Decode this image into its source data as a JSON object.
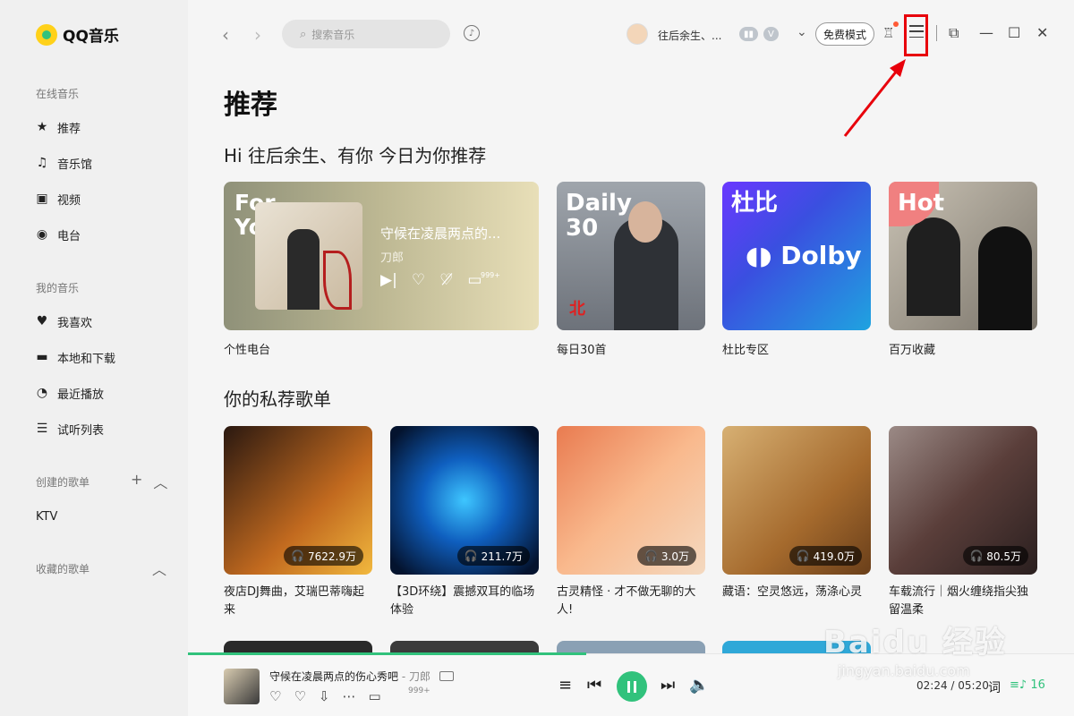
{
  "app": {
    "name": "QQ音乐"
  },
  "sidebar": {
    "online_title": "在线音乐",
    "online_items": [
      {
        "label": "推荐",
        "icon": "star-icon"
      },
      {
        "label": "音乐馆",
        "icon": "music-note-icon"
      },
      {
        "label": "视频",
        "icon": "video-icon"
      },
      {
        "label": "电台",
        "icon": "radio-icon"
      }
    ],
    "mine_title": "我的音乐",
    "mine_items": [
      {
        "label": "我喜欢",
        "icon": "heart-icon"
      },
      {
        "label": "本地和下载",
        "icon": "monitor-icon"
      },
      {
        "label": "最近播放",
        "icon": "clock-icon"
      },
      {
        "label": "试听列表",
        "icon": "playlist-icon"
      }
    ],
    "created_title": "创建的歌单",
    "created_items": [
      {
        "label": "KTV"
      }
    ],
    "collected_title": "收藏的歌单"
  },
  "topbar": {
    "search_placeholder": "搜索音乐",
    "username": "往后余生、...",
    "badge_1": "▮▮",
    "badge_2": "V",
    "free_mode": "免费模式"
  },
  "main": {
    "title": "推荐",
    "greeting": "Hi 往后余生、有你 今日为你推荐",
    "for_you": {
      "title_line1": "For",
      "title_line2": "You",
      "song": "守候在凌晨两点的...",
      "artist": "刀郎",
      "comment_count": "999+",
      "label": "个性电台"
    },
    "daily": {
      "title_line1": "Daily",
      "title_line2": "30",
      "subtitle": "北",
      "label": "每日30首"
    },
    "dolby": {
      "title": "杜比",
      "logo": "Dolby",
      "label": "杜比专区"
    },
    "hot": {
      "title": "Hot",
      "label": "百万收藏"
    },
    "section2_title": "你的私荐歌单",
    "playlists": [
      {
        "plays": "7622.9万",
        "title": "夜店DJ舞曲，艾瑞巴蒂嗨起来"
      },
      {
        "plays": "211.7万",
        "title": "【3D环绕】震撼双耳的临场体验"
      },
      {
        "plays": "3.0万",
        "title": "古灵精怪 · 才不做无聊的大人!"
      },
      {
        "plays": "419.0万",
        "title": "藏语：空灵悠远，荡涤心灵"
      },
      {
        "plays": "80.5万",
        "title": "车载流行｜烟火缠绕指尖独留温柔"
      }
    ]
  },
  "player": {
    "song": "守候在凌晨两点的伤心秀吧",
    "artist": "刀郎",
    "comment_count": "999+",
    "time": "02:24 / 05:20",
    "lyric_label": "词",
    "queue_count": "16"
  },
  "watermark": {
    "main": "Baidu 经验",
    "sub": "jingyan.baidu.com"
  },
  "colors": {
    "accent": "#31c27c",
    "highlight": "#e8000b"
  }
}
